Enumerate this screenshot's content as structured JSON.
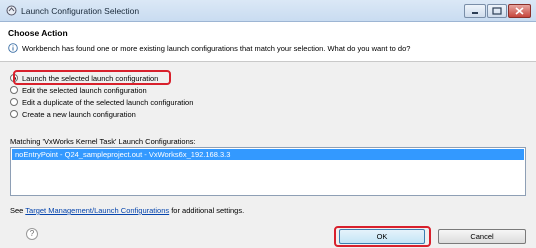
{
  "window": {
    "title": "Launch Configuration Selection"
  },
  "header": {
    "title": "Choose Action",
    "message": "Workbench has found one or more existing launch configurations that match your selection. What do you want to do?"
  },
  "options": [
    {
      "label": "Launch the selected launch configuration",
      "selected": true
    },
    {
      "label": "Edit the selected launch configuration",
      "selected": false
    },
    {
      "label": "Edit a duplicate of the selected launch configuration",
      "selected": false
    },
    {
      "label": "Create a new launch configuration",
      "selected": false
    }
  ],
  "matching": {
    "label": "Matching 'VxWorks Kernel Task' Launch Configurations:",
    "items": [
      "noEntryPoint - Q24_sampleproject.out - VxWorks6x_192.168.3.3"
    ]
  },
  "footer": {
    "see_prefix": "See ",
    "link_text": "Target Management/Launch Configurations",
    "see_suffix": " for additional settings."
  },
  "buttons": {
    "help": "?",
    "ok": "OK",
    "cancel": "Cancel"
  }
}
